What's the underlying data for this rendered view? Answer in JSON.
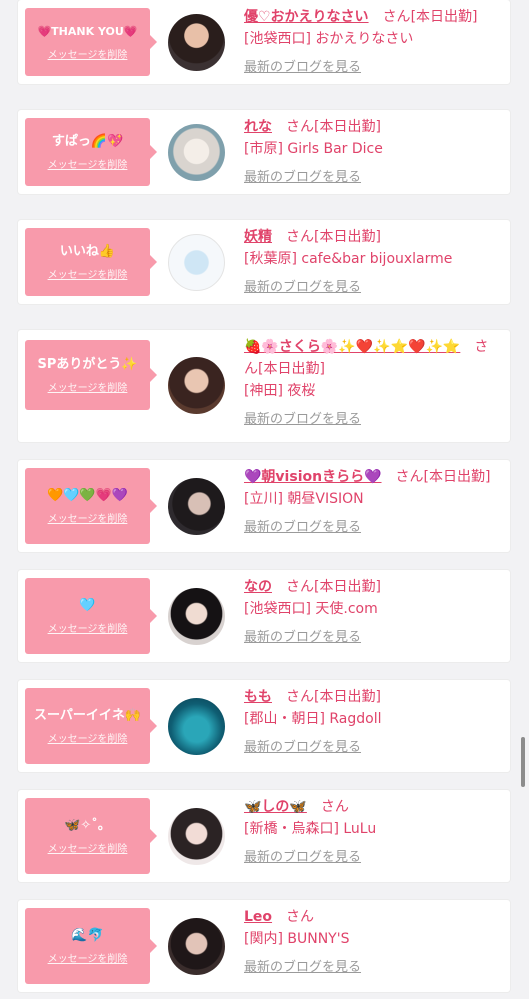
{
  "delete_label": "メッセージを削除",
  "blog_label": "最新のブログを見る",
  "san": "さん",
  "status_today": "[本日出勤]",
  "colors": {
    "stamp_bg": "#f89aab",
    "name": "#e0436a",
    "blog_link": "#9a9a9a",
    "page_bg": "#f2f2f4"
  },
  "items": [
    {
      "stamp": "💗THANK YOU💗",
      "name": "優♡おかえりなさい",
      "status": "[本日出勤]",
      "shop": "[池袋西口] おかえりなさい",
      "avatar_icon": "girl-photo"
    },
    {
      "stamp": "すぱっ🌈💖",
      "name": "れな",
      "status": "[本日出勤]",
      "shop": "[市原] Girls Bar Dice",
      "avatar_icon": "cat-filter-photo"
    },
    {
      "stamp": "いいね👍",
      "name": "妖精",
      "status": "[本日出勤]",
      "shop": "[秋葉原] cafe&bar bijouxlarme",
      "avatar_icon": "fairy-character"
    },
    {
      "stamp": "SPありがとう✨",
      "name": "🍓🌸さくら🌸✨❤️✨⭐️❤️✨⭐️",
      "status": "[本日出勤]",
      "shop": "[神田] 夜桜",
      "avatar_icon": "girl-photo"
    },
    {
      "stamp": "🧡🩵💚💗💜",
      "name": "💜朝visionきらら💜",
      "status": "[本日出勤]",
      "shop": "[立川] 朝昼VISION",
      "avatar_icon": "girl-photo"
    },
    {
      "stamp": "🩵",
      "name": "なの",
      "status": "[本日出勤]",
      "shop": "[池袋西口] 天使.com",
      "avatar_icon": "girl-photo"
    },
    {
      "stamp": "スーパーイイネ🙌",
      "name": "もも",
      "status": "[本日出勤]",
      "shop": "[郡山・朝日] Ragdoll",
      "avatar_icon": "aquarium-photo"
    },
    {
      "stamp": "🦋✧˚。",
      "name": "🦋しの🦋",
      "status": "",
      "shop": "[新橋・烏森口] LuLu",
      "avatar_icon": "girl-photo"
    },
    {
      "stamp": "🌊🐬",
      "name": "Leo",
      "status": "",
      "shop": "[関内] BUNNY'S",
      "avatar_icon": "girl-photo"
    }
  ]
}
